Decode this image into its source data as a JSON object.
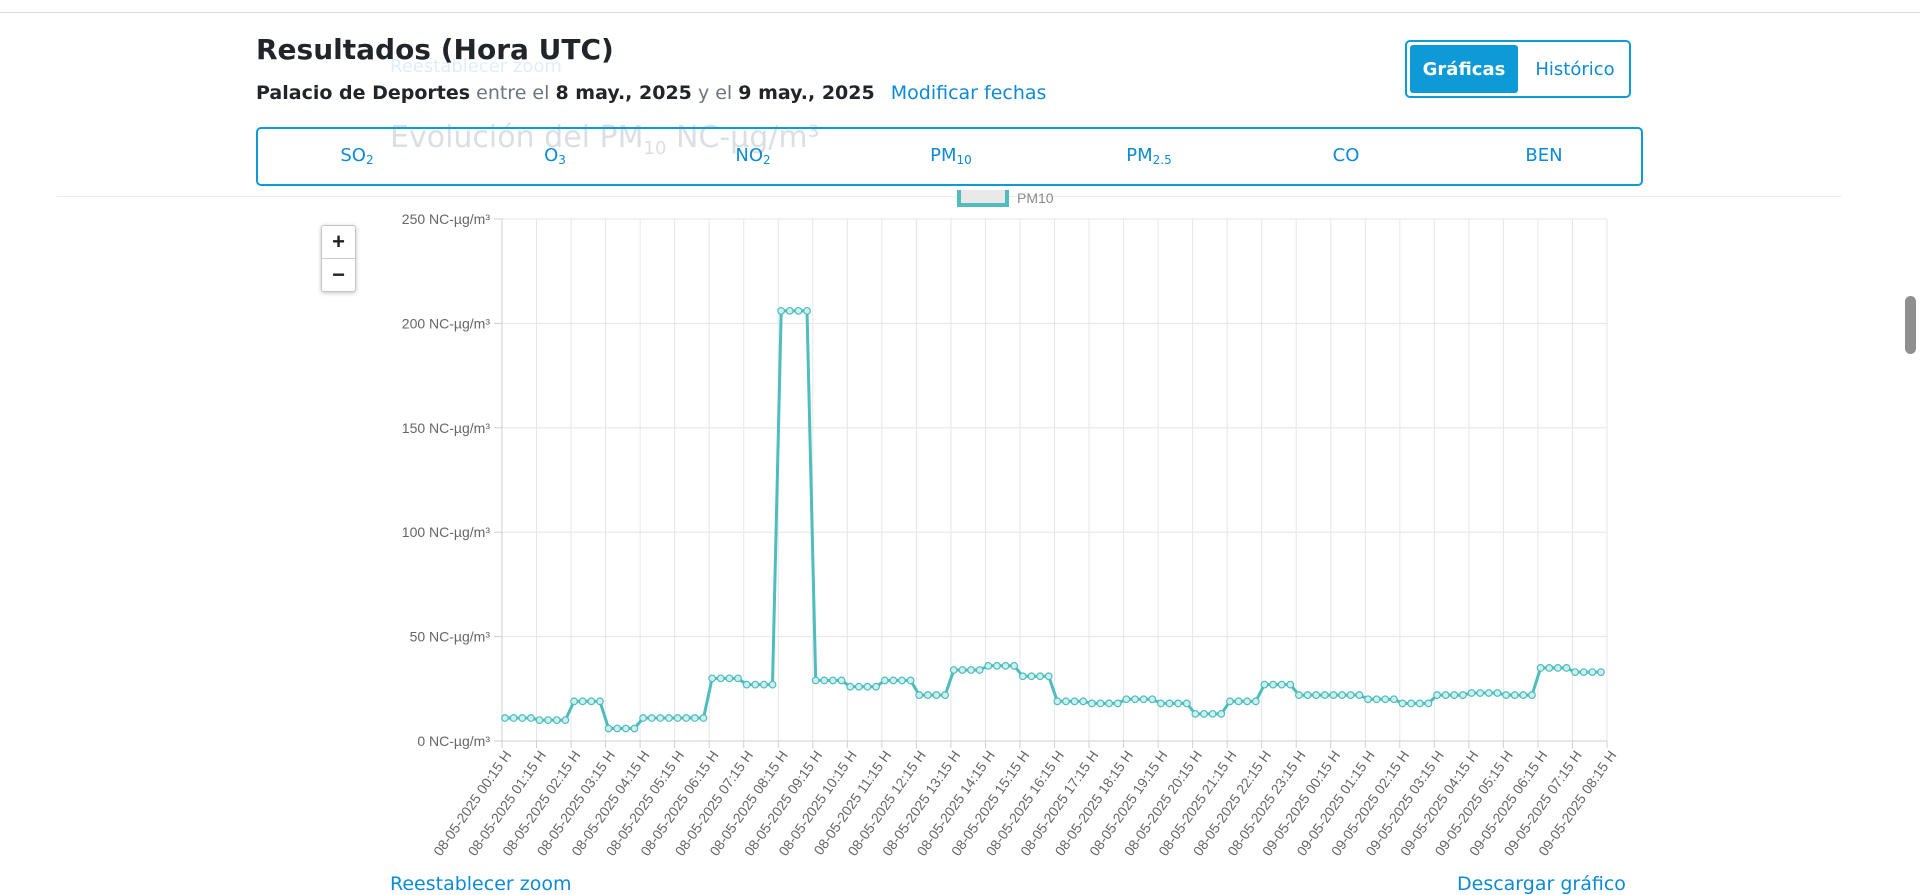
{
  "header": {
    "title": "Resultados (Hora UTC)",
    "station": "Palacio de Deportes",
    "between": "entre el",
    "date_from": "8 may., 2025",
    "and": "y el",
    "date_to": "9 may., 2025",
    "modify_link": "Modificar fechas"
  },
  "view_toggle": {
    "active": "Gráficas",
    "inactive": "Histórico"
  },
  "pollutant_tabs": [
    {
      "base": "SO",
      "sub": "2"
    },
    {
      "base": "O",
      "sub": "3"
    },
    {
      "base": "NO",
      "sub": "2"
    },
    {
      "base": "PM",
      "sub": "10"
    },
    {
      "base": "PM",
      "sub": "2.5"
    },
    {
      "base": "CO",
      "sub": ""
    },
    {
      "base": "BEN",
      "sub": ""
    }
  ],
  "ghost": {
    "reset_zoom_top": "Reestablecer zoom",
    "chart_title_base": "Evolución del PM",
    "chart_title_sub": "10",
    "chart_title_unit": "NC-µg/m³",
    "legend_label": "PM10"
  },
  "zoom": {
    "plus": "+",
    "minus": "−"
  },
  "bottom_links": {
    "reset_zoom": "Reestablecer zoom",
    "download": "Descargar gráfico"
  },
  "colors": {
    "accent": "#0d9ad6",
    "series": "#4dbdbd",
    "grid": "#e6e6e6"
  },
  "chart_data": {
    "type": "line",
    "series": [
      {
        "name": "PM10",
        "values": [
          11,
          11,
          11,
          11,
          10,
          10,
          10,
          10,
          19,
          19,
          19,
          19,
          6,
          6,
          6,
          6,
          11,
          11,
          11,
          11,
          11,
          11,
          11,
          11,
          30,
          30,
          30,
          30,
          27,
          27,
          27,
          27,
          206,
          206,
          206,
          206,
          29,
          29,
          29,
          29,
          26,
          26,
          26,
          26,
          29,
          29,
          29,
          29,
          22,
          22,
          22,
          22,
          34,
          34,
          34,
          34,
          36,
          36,
          36,
          36,
          31,
          31,
          31,
          31,
          19,
          19,
          19,
          19,
          18,
          18,
          18,
          18,
          20,
          20,
          20,
          20,
          18,
          18,
          18,
          18,
          13,
          13,
          13,
          13,
          19,
          19,
          19,
          19,
          27,
          27,
          27,
          27,
          22,
          22,
          22,
          22,
          22,
          22,
          22,
          22,
          20,
          20,
          20,
          20,
          18,
          18,
          18,
          18,
          22,
          22,
          22,
          22,
          23,
          23,
          23,
          23,
          22,
          22,
          22,
          22,
          35,
          35,
          35,
          35,
          33,
          33,
          33,
          33
        ]
      }
    ],
    "x_tick_labels": [
      "08-05-2025 00:15 H",
      "08-05-2025 01:15 H",
      "08-05-2025 02:15 H",
      "08-05-2025 03:15 H",
      "08-05-2025 04:15 H",
      "08-05-2025 05:15 H",
      "08-05-2025 06:15 H",
      "08-05-2025 07:15 H",
      "08-05-2025 08:15 H",
      "08-05-2025 09:15 H",
      "08-05-2025 10:15 H",
      "08-05-2025 11:15 H",
      "08-05-2025 12:15 H",
      "08-05-2025 13:15 H",
      "08-05-2025 14:15 H",
      "08-05-2025 15:15 H",
      "08-05-2025 16:15 H",
      "08-05-2025 17:15 H",
      "08-05-2025 18:15 H",
      "08-05-2025 19:15 H",
      "08-05-2025 20:15 H",
      "08-05-2025 21:15 H",
      "08-05-2025 22:15 H",
      "08-05-2025 23:15 H",
      "09-05-2025 00:15 H",
      "09-05-2025 01:15 H",
      "09-05-2025 02:15 H",
      "09-05-2025 03:15 H",
      "09-05-2025 04:15 H",
      "09-05-2025 05:15 H",
      "09-05-2025 06:15 H",
      "09-05-2025 07:15 H",
      "09-05-2025 08:15 H"
    ],
    "y_ticks": [
      0,
      50,
      100,
      150,
      200,
      250
    ],
    "y_tick_suffix": " NC-µg/m³",
    "ylim": [
      0,
      250
    ],
    "grid": true
  }
}
